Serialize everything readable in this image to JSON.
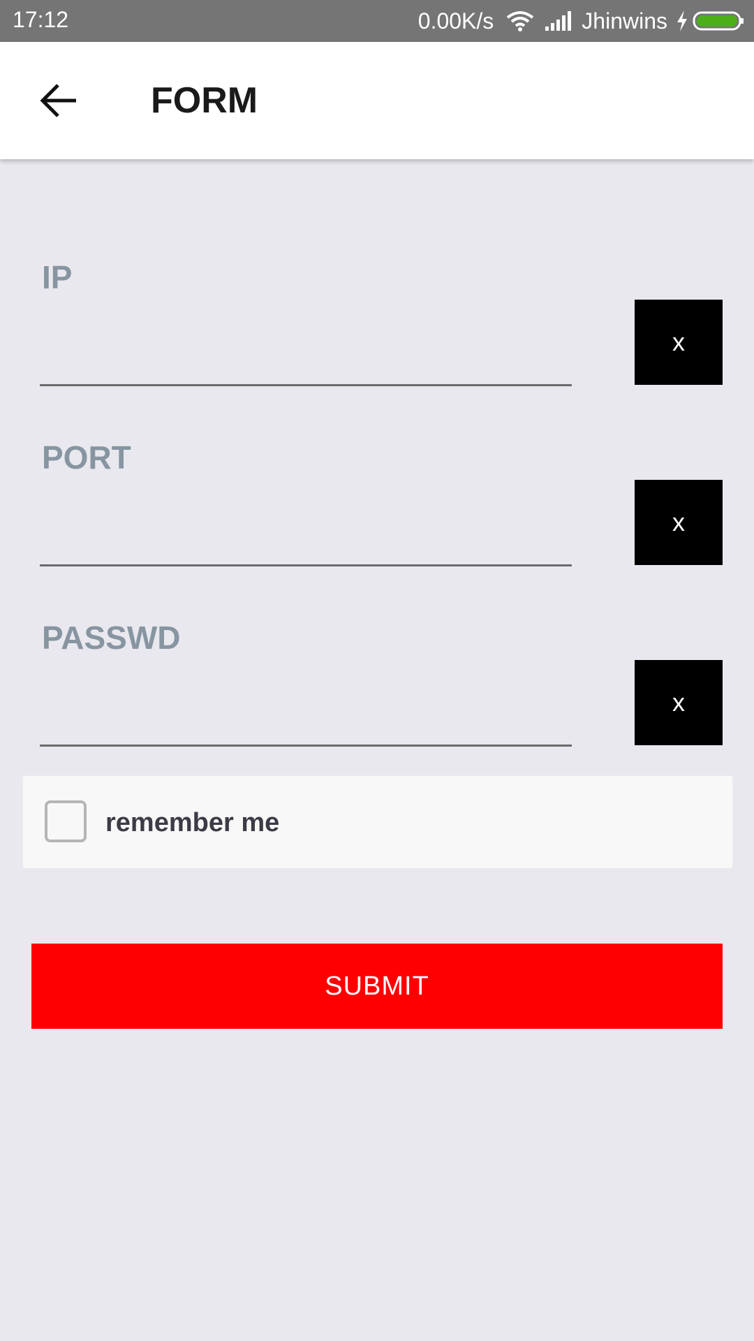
{
  "status_bar": {
    "time": "17:12",
    "net_speed": "0.00K/s",
    "carrier": "Jhinwins",
    "icons": [
      "wifi-icon",
      "signal-icon",
      "charging-bolt-icon",
      "battery-icon"
    ],
    "battery_color": "#4caf1a"
  },
  "app_bar": {
    "back_icon": "arrow-left-icon",
    "title": "FORM"
  },
  "form": {
    "fields": [
      {
        "label": "IP",
        "value": "",
        "clear_label": "x"
      },
      {
        "label": "PORT",
        "value": "",
        "clear_label": "x"
      },
      {
        "label": "PASSWD",
        "value": "",
        "clear_label": "x"
      }
    ],
    "remember": {
      "label": "remember me",
      "checked": false
    },
    "submit_label": "SUBMIT"
  },
  "colors": {
    "background": "#e8e8ee",
    "status_bar": "#757575",
    "label": "#8795a1",
    "clear_button": "#000000",
    "submit_button": "#ff0000"
  }
}
